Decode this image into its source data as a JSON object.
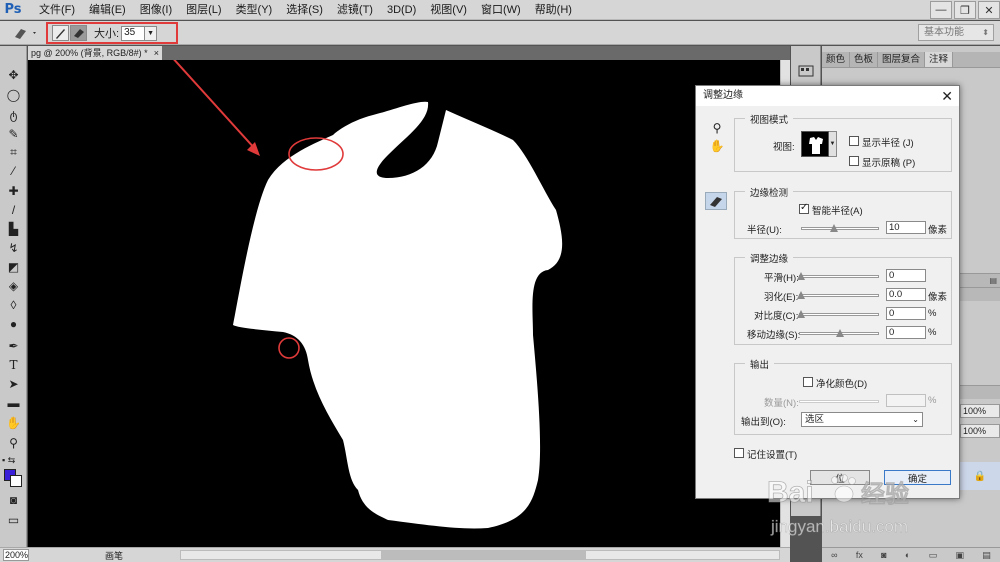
{
  "app": {
    "logo": "Ps"
  },
  "menu": [
    "文件(F)",
    "编辑(E)",
    "图像(I)",
    "图层(L)",
    "类型(Y)",
    "选择(S)",
    "滤镜(T)",
    "3D(D)",
    "视图(V)",
    "窗口(W)",
    "帮助(H)"
  ],
  "window_controls": [
    "—",
    "❐",
    "✕"
  ],
  "options": {
    "size_label": "大小:",
    "size_value": "35",
    "workspace": "基本功能"
  },
  "document": {
    "tab_title": "pg @ 200% (背景, RGB/8#) *",
    "close": "×"
  },
  "status": {
    "zoom": "200%",
    "tool": "画笔"
  },
  "panel_tabs": [
    "颜色",
    "色板",
    "图层复合",
    "注释"
  ],
  "panel_pct": [
    "100%",
    "100%"
  ],
  "colors": {
    "foreground": "#3a1fd8",
    "background": "#ffffff",
    "annotation": "#e03a3a"
  },
  "dialog": {
    "title": "调整边缘",
    "close": "✕",
    "view_mode": {
      "title": "视图模式",
      "view_label": "视图:",
      "show_radius": "显示半径 (J)",
      "show_original": "显示原稿 (P)"
    },
    "edge_detection": {
      "title": "边缘检测",
      "smart_radius": "智能半径(A)",
      "radius_label": "半径(U):",
      "radius_value": "10",
      "radius_unit": "像素"
    },
    "adjust_edge": {
      "title": "调整边缘",
      "smooth_label": "平滑(H):",
      "smooth_value": "0",
      "feather_label": "羽化(E):",
      "feather_value": "0.0",
      "feather_unit": "像素",
      "contrast_label": "对比度(C):",
      "contrast_value": "0",
      "contrast_unit": "%",
      "shift_label": "移动边缘(S):",
      "shift_value": "0",
      "shift_unit": "%"
    },
    "output": {
      "title": "输出",
      "decontaminate": "净化颜色(D)",
      "amount_label": "数量(N):",
      "amount_unit": "%",
      "output_to_label": "输出到(O):",
      "output_to_value": "选区"
    },
    "remember": "记住设置(T)",
    "cancel_partial": "位",
    "ok": "确定"
  },
  "watermark": {
    "brand": "Bai",
    "brand2": "经验",
    "url": "jingyan.baidu.com"
  }
}
